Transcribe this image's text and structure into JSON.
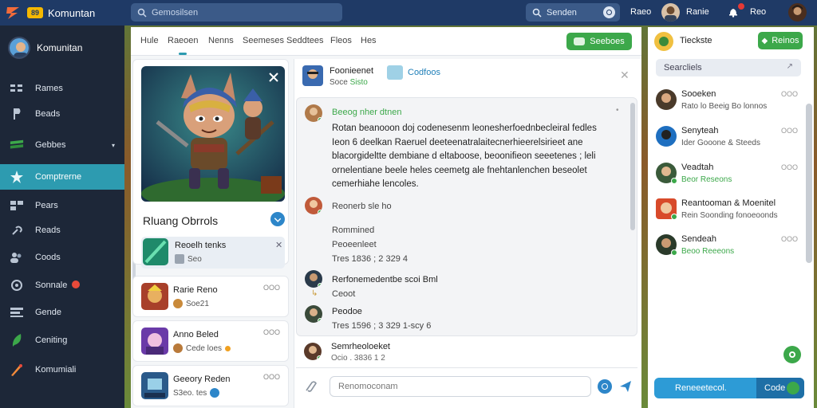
{
  "topbar": {
    "app_badge": "89",
    "app_title": "Komuntan",
    "search_placeholder": "Gemosilsen",
    "search2_text": "Senden",
    "label_a": "Raeo",
    "user_name": "Ranie",
    "label_b": "Reo"
  },
  "sidebar": {
    "profile_name": "Komunitan",
    "items": [
      {
        "label": "Rames"
      },
      {
        "label": "Beads"
      },
      {
        "label": "Gebbes"
      },
      {
        "label": "Comptrerne"
      },
      {
        "label": "Pears"
      },
      {
        "label": "Reads"
      },
      {
        "label": "Coods"
      },
      {
        "label": "Sonnale"
      },
      {
        "label": "Gende"
      },
      {
        "label": "Ceniting"
      },
      {
        "label": "Komumiali"
      }
    ]
  },
  "tabs": [
    "Hule",
    "Raeoen",
    "Nenns",
    "Seemeses",
    "Seddtees",
    "Fleos",
    "Hes"
  ],
  "new_button": "Seeboes",
  "hero": {
    "title": "Rluang Obrrols",
    "sub_name": "Reoelh tenks",
    "sub_meta": "Seo"
  },
  "cards": [
    {
      "name": "Rarie Reno",
      "meta": "Soe21",
      "time": "OOO"
    },
    {
      "name": "Anno Beled",
      "meta": "Cede loes",
      "time": "OOO"
    },
    {
      "name": "Geeory Reden",
      "meta": "S3eo. tes",
      "time": "OOO"
    }
  ],
  "chat": {
    "head_name": "Foonieenet",
    "head_sub_a": "Soce",
    "head_sub_b": "Sisto",
    "tag": "Codfoos",
    "msg1_head": "Beeog nher dtnen",
    "msg1_body": [
      "Rotan beanooon doj codenesenm leonesherfoednbecleiral fedles",
      "Ieon  6 deelkan Raeruel deeteenatralaitecnerhieerelsirieet ane",
      "blacorgideltte dembiane d eltaboose, beoonifieon seeetenes ; leli",
      "ornelentiane beele heles ceemetg ale fnehtanlenchen beseolet",
      "cemerhiahe lencoles."
    ],
    "msg2_head": "Reonerb sle ho",
    "msg2_lines": [
      "Rommined",
      "Peoeenleet",
      "Tres   1836  ; 2 329  4"
    ],
    "msg3_head": "Rerfonemedentbe scoi Bml",
    "msg3_sub": "Ceoot",
    "msg4_head": "Peodoe",
    "msg4_sub": "Tres   1596  ; 3 329  1-scy 6",
    "bottom_name": "Semrheoloeket",
    "bottom_sub": "Ocio  . 3836 1 2",
    "composer_placeholder": "Renomoconam"
  },
  "right": {
    "title": "Tieckste",
    "button": "Reinos",
    "search": "Searcliels",
    "contacts": [
      {
        "name": "Sooeken",
        "status": "Rato lo Beeig Bo lonnos",
        "time": "OOO"
      },
      {
        "name": "Senyteah",
        "status": "Ider Gooone & Steeds",
        "time": "OOO"
      },
      {
        "name": "Veadtah",
        "status": "Beor Reseons",
        "time": "OOO"
      },
      {
        "name": "Reantooman & Moenitel",
        "status": "Rein Soonding fonoeoonds",
        "time": ""
      },
      {
        "name": "Sendeah",
        "status": "Beoo Reeeons",
        "time": "OOO"
      }
    ],
    "input_text": "Reneeetecol.",
    "input_right": "Code"
  },
  "colors": {
    "accent": "#2d9bb0",
    "green": "#3ca84a",
    "nav": "#1f3a66",
    "sidebar": "#1d2738"
  }
}
